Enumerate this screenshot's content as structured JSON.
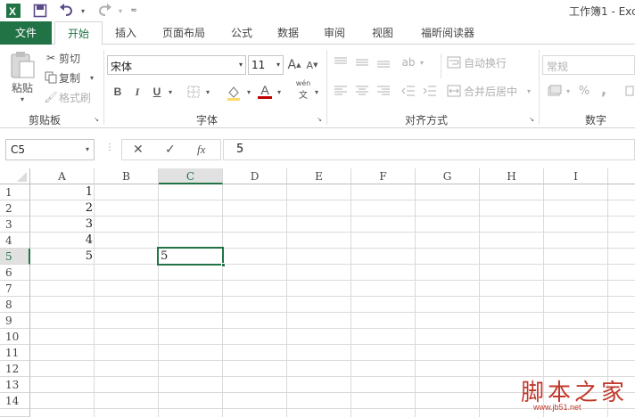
{
  "window": {
    "title": "工作簿1 - Exc"
  },
  "icons": {
    "app": "excel-icon",
    "save": "save-icon",
    "undo": "undo-icon",
    "redo": "redo-icon",
    "customize": "customize-qat-icon"
  },
  "tabs": [
    {
      "label": "文件"
    },
    {
      "label": "开始"
    },
    {
      "label": "插入"
    },
    {
      "label": "页面布局"
    },
    {
      "label": "公式"
    },
    {
      "label": "数据"
    },
    {
      "label": "审阅"
    },
    {
      "label": "视图"
    },
    {
      "label": "福昕阅读器"
    }
  ],
  "ribbon": {
    "clipboard": {
      "paste": "粘贴",
      "cut": "剪切",
      "copy": "复制",
      "format_painter": "格式刷",
      "label": "剪贴板"
    },
    "font": {
      "name": "宋体",
      "size": "11",
      "bold": "B",
      "italic": "I",
      "underline": "U",
      "grow": "A",
      "shrink": "A",
      "color_a": "A",
      "phonetic": "wén",
      "label": "字体"
    },
    "alignment": {
      "wrap": "自动换行",
      "merge": "合并后居中",
      "label": "对齐方式"
    },
    "number": {
      "format": "常规",
      "percent": "%",
      "comma": ",",
      "label": "数字"
    }
  },
  "formula_bar": {
    "name_box": "C5",
    "cancel": "✕",
    "enter": "✓",
    "fx": "fx",
    "content": "5"
  },
  "columns": [
    "A",
    "B",
    "C",
    "D",
    "E",
    "F",
    "G",
    "H",
    "I"
  ],
  "rows": [
    "1",
    "2",
    "3",
    "4",
    "5",
    "6",
    "7",
    "8",
    "9",
    "10",
    "11",
    "12",
    "13",
    "14"
  ],
  "cells": {
    "A1": "1",
    "A2": "2",
    "A3": "3",
    "A4": "4",
    "A5": "5",
    "C5": "5"
  },
  "watermark": {
    "text": "脚本之家",
    "url": "www.jb51.net"
  },
  "colors": {
    "accent": "#217346",
    "watermark": "#c0392b"
  }
}
